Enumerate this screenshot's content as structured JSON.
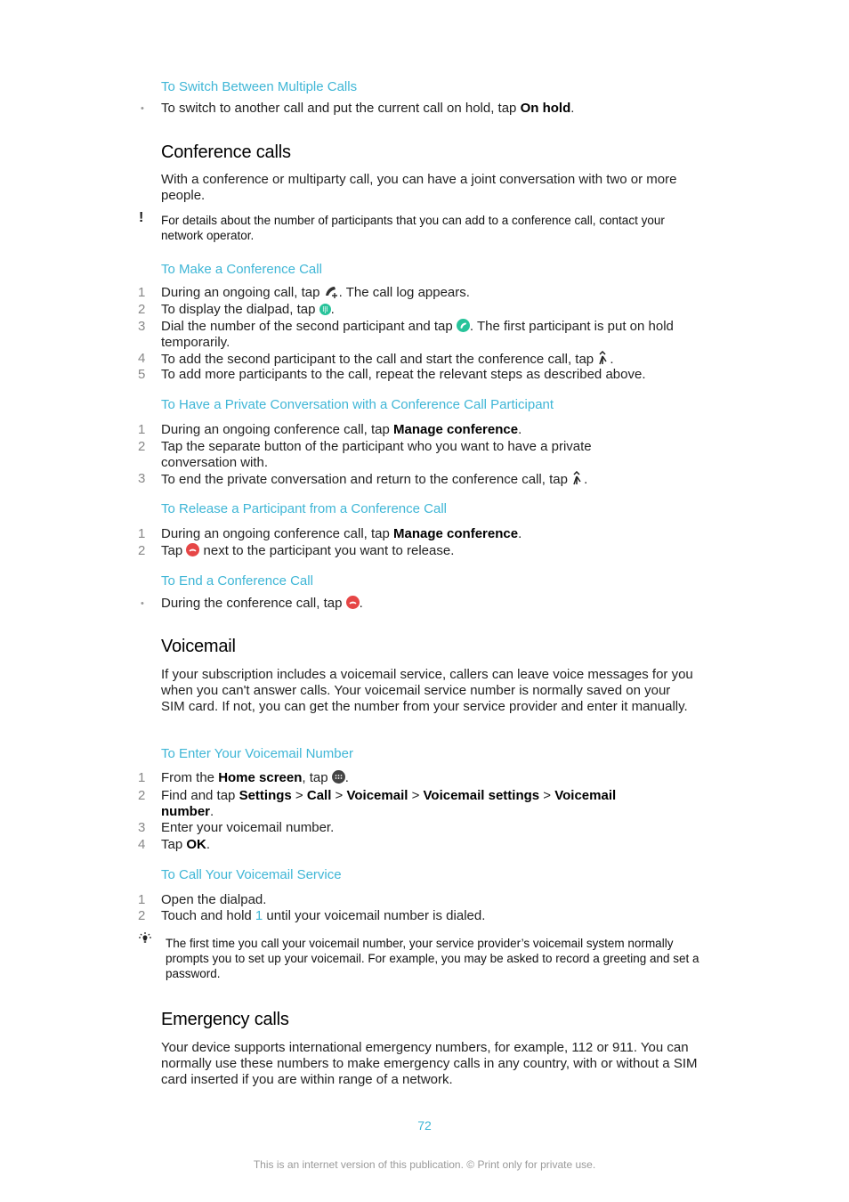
{
  "switch_section": {
    "heading": "To Switch Between Multiple Calls",
    "bullet_text": "To switch to another call and put the current call on hold, tap ",
    "bullet_bold": "On hold",
    "bullet_end": "."
  },
  "conference": {
    "title": "Conference calls",
    "intro": "With a conference or multiparty call, you can have a joint conversation with two or more people.",
    "note": "For details about the number of participants that you can add to a conference call, contact your network operator.",
    "make": {
      "heading": "To Make a Conference Call",
      "steps": [
        {
          "num": "1",
          "before": "During an ongoing call, tap ",
          "after": ". The call log appears.",
          "icon": "add-call-icon"
        },
        {
          "num": "2",
          "before": "To display the dialpad, tap ",
          "after": ".",
          "icon": "dialpad-icon"
        },
        {
          "num": "3",
          "before": "Dial the number of the second participant and tap ",
          "after": ". The first participant is put on hold temporarily.",
          "icon": "call-icon"
        },
        {
          "num": "4",
          "before": "To add the second participant to the call and start the conference call, tap ",
          "after": ".",
          "icon": "merge-calls-icon"
        },
        {
          "num": "5",
          "before": "To add more participants to the call, repeat the relevant steps as described above.",
          "after": ""
        }
      ]
    },
    "private": {
      "heading": "To Have a Private Conversation with a Conference Call Participant",
      "steps": [
        {
          "num": "1",
          "before": "During an ongoing conference call, tap ",
          "bold": "Manage conference",
          "after": "."
        },
        {
          "num": "2",
          "before": "Tap the separate button of the participant who you want to have a private conversation with."
        },
        {
          "num": "3",
          "before": "To end the private conversation and return to the conference call, tap ",
          "after": ".",
          "icon": "merge-calls-icon"
        }
      ]
    },
    "release": {
      "heading": "To Release a Participant from a Conference Call",
      "steps": [
        {
          "num": "1",
          "before": "During an ongoing conference call, tap ",
          "bold": "Manage conference",
          "after": "."
        },
        {
          "num": "2",
          "before": "Tap ",
          "after": " next to the participant you want to release.",
          "icon": "end-call-icon"
        }
      ]
    },
    "end": {
      "heading": "To End a Conference Call",
      "bullet_before": "During the conference call, tap ",
      "bullet_after": ".",
      "icon": "end-call-icon"
    }
  },
  "voicemail": {
    "title": "Voicemail",
    "intro": "If your subscription includes a voicemail service, callers can leave voice messages for you when you can't answer calls. Your voicemail service number is normally saved on your SIM card. If not, you can get the number from your service provider and enter it manually.",
    "enter": {
      "heading": "To Enter Your Voicemail Number",
      "step1": {
        "num": "1",
        "before": "From the ",
        "bold": "Home screen",
        "mid": ", tap ",
        "after": ".",
        "icon": "apps-icon"
      },
      "step2": {
        "num": "2",
        "before": "Find and tap ",
        "path": [
          "Settings",
          "Call",
          "Voicemail",
          "Voicemail settings",
          "Voicemail number"
        ],
        "sep": " > ",
        "after": "."
      },
      "step3": {
        "num": "3",
        "text": "Enter your voicemail number."
      },
      "step4": {
        "num": "4",
        "before": "Tap ",
        "bold": "OK",
        "after": "."
      }
    },
    "call": {
      "heading": "To Call Your Voicemail Service",
      "step1": {
        "num": "1",
        "text": "Open the dialpad."
      },
      "step2": {
        "num": "2",
        "before": "Touch and hold ",
        "key": "1",
        "after": " until your voicemail number is dialed."
      }
    },
    "tip": "The first time you call your voicemail number, your service provider’s voicemail system normally prompts you to set up your voicemail. For example, you may be asked to record a greeting and set a password."
  },
  "emergency": {
    "title": "Emergency calls",
    "intro": "Your device supports international emergency numbers, for example, 112 or 911. You can normally use these numbers to make emergency calls in any country, with or without a SIM card inserted if you are within range of a network."
  },
  "footer": {
    "page_number": "72",
    "notice": "This is an internet version of this publication. © Print only for private use."
  },
  "colors": {
    "accent": "#3fb6d6",
    "call_green": "#27c39a",
    "end_red": "#e64646"
  }
}
